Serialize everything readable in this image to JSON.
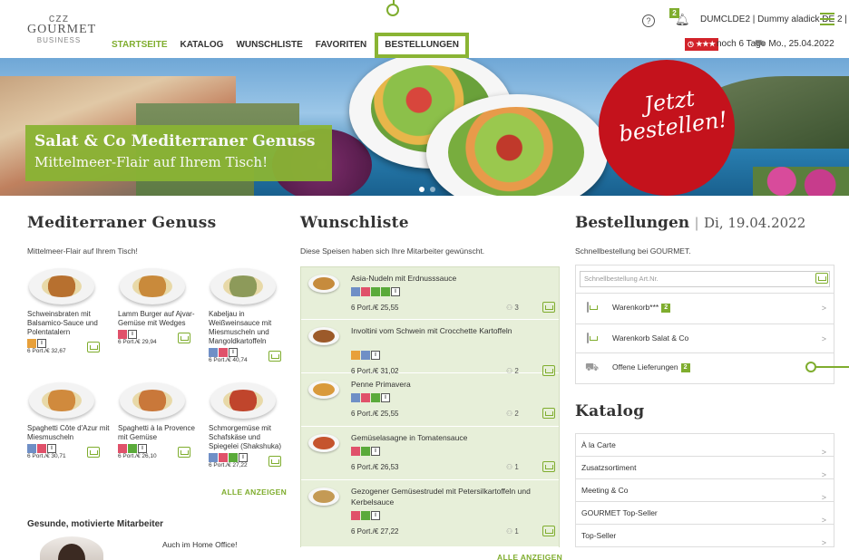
{
  "header": {
    "logo_crown": "ᴄᴢᴢ",
    "logo_line1": "GOURMET",
    "logo_line2": "BUSINESS",
    "nav": [
      "STARTSEITE",
      "KATALOG",
      "WUNSCHLISTE",
      "FAVORITEN",
      "BESTELLUNGEN"
    ],
    "help": "?",
    "notification_count": "2",
    "user": "DUMCLDE2 | Dummy aladick DE 2 |",
    "timer_label": "★★★",
    "days_left": "noch 6 Tage",
    "delivery_date": "Mo., 25.04.2022"
  },
  "hero": {
    "title": "Salat & Co Mediterraner Genuss",
    "subtitle": "Mittelmeer-Flair auf Ihrem Tisch!",
    "cta_line1": "Jetzt",
    "cta_line2": "bestellen!"
  },
  "mediterran": {
    "title": "Mediterraner Genuss",
    "subtitle": "Mittelmeer-Flair auf Ihrem Tisch!",
    "products": [
      {
        "name": "Schweinsbraten mit Balsamico-Sauce und Polentatalern",
        "price": "6 Port./€ 32,67",
        "color": "#b7702f"
      },
      {
        "name": "Lamm Burger auf Ajvar-Gemüse mit Wedges",
        "price": "6 Port./€ 29,94",
        "color": "#c98a3b"
      },
      {
        "name": "Kabeljau in Weißweinsauce mit Miesmuscheln und Mangoldkartoffeln",
        "price": "6 Port./€ 40,74",
        "color": "#8d9a5a"
      },
      {
        "name": "Spaghetti Côte d'Azur mit Miesmuscheln",
        "price": "6 Port./€ 30,71",
        "color": "#d08a3d"
      },
      {
        "name": "Spaghetti à la Provence mit Gemüse",
        "price": "6 Port./€ 26,10",
        "color": "#c9783a"
      },
      {
        "name": "Schmorgemüse mit Schafskäse und Spiegelei (Shakshuka)",
        "price": "6 Port./€ 27,22",
        "color": "#c0452c"
      }
    ],
    "show_all": "ALLE ANZEIGEN"
  },
  "health": {
    "title": "Gesunde, motivierte Mitarbeiter",
    "text": "Auch im Home Office!"
  },
  "wishlist": {
    "title": "Wunschliste",
    "subtitle": "Diese Speisen haben sich Ihre Mitarbeiter gewünscht.",
    "items": [
      {
        "name": "Asia-Nudeln mit Erdnusssauce",
        "price": "6 Port./€ 25,55",
        "count": "3",
        "color": "#c68b3d"
      },
      {
        "name": "Involtini vom Schwein mit Crocchette Kartoffeln",
        "price": "6 Port./€ 31,02",
        "count": "2",
        "color": "#9c5a2a"
      },
      {
        "name": "Penne Primavera",
        "price": "6 Port./€ 25,55",
        "count": "2",
        "color": "#d99a3c"
      },
      {
        "name": "Gemüselasagne in Tomatensauce",
        "price": "6 Port./€ 26,53",
        "count": "1",
        "color": "#c5542e"
      },
      {
        "name": "Gezogener Gemüsestrudel mit Petersilkartoffeln und Kerbelsauce",
        "price": "6 Port./€ 27,22",
        "count": "1",
        "color": "#c49a55"
      }
    ],
    "show_all": "ALLE ANZEIGEN"
  },
  "orders": {
    "title": "Bestellungen",
    "date": "Di, 19.04.2022",
    "subtitle": "Schnellbestellung bei GOURMET.",
    "quick_placeholder": "Schnellbestellung Art.Nr.",
    "rows": [
      {
        "label": "Warenkorb***",
        "badge": "2"
      },
      {
        "label": "Warenkorb Salat & Co",
        "badge": ""
      },
      {
        "label": "Offene Lieferungen",
        "badge": "2"
      }
    ]
  },
  "catalog": {
    "title": "Katalog",
    "rows": [
      "À la Carte",
      "Zusatzsortiment",
      "Meeting & Co",
      "GOURMET Top-Seller",
      "Top-Seller"
    ]
  },
  "icon_colors": {
    "blue": "#6f8fc6",
    "red": "#e0516a",
    "green": "#5aaa3a",
    "orange": "#e8a03a",
    "accent": "#7fad2e"
  }
}
